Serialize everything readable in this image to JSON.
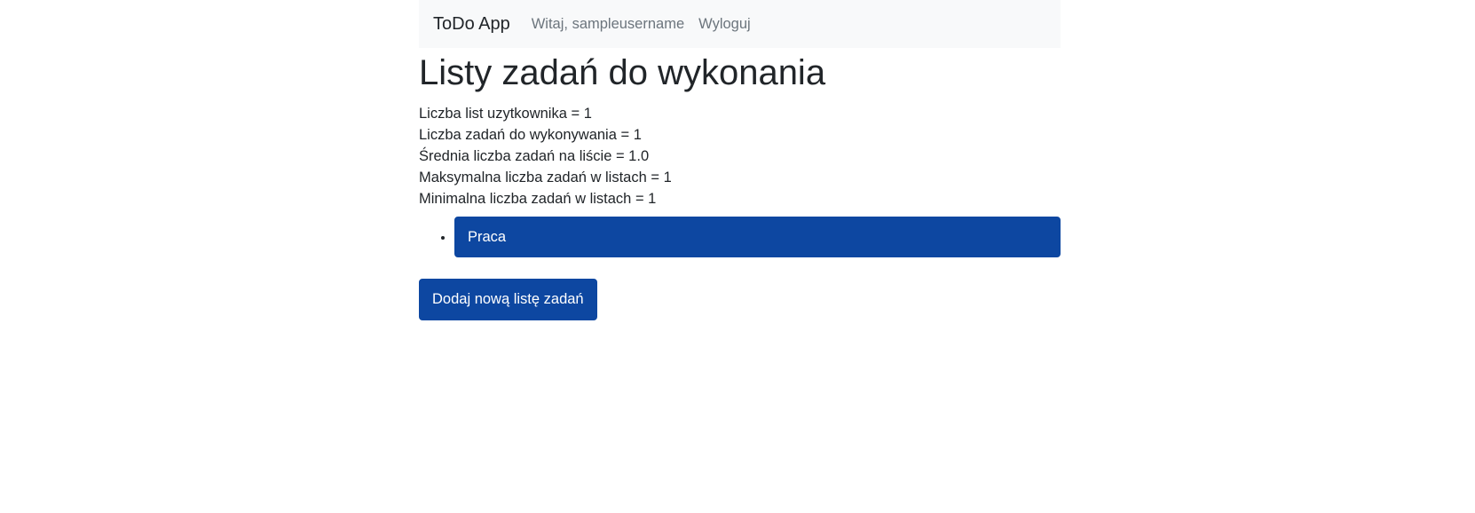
{
  "navbar": {
    "brand": "ToDo App",
    "greeting": "Witaj, sampleusername",
    "logout": "Wyloguj"
  },
  "main": {
    "title": "Listy zadań do wykonania",
    "stats": [
      "Liczba list uzytkownika = 1",
      "Liczba zadań do wykonywania = 1",
      "Średnia liczba zadań na liście = 1.0",
      "Maksymalna liczba zadań w listach = 1",
      "Minimalna liczba zadań w listach = 1"
    ],
    "lists": [
      {
        "label": "Praca"
      }
    ],
    "add_button_label": "Dodaj nową listę zadań"
  },
  "colors": {
    "primary": "#0d47a1",
    "navbar_bg": "#f8f9fa",
    "muted_text": "#6c757d"
  }
}
